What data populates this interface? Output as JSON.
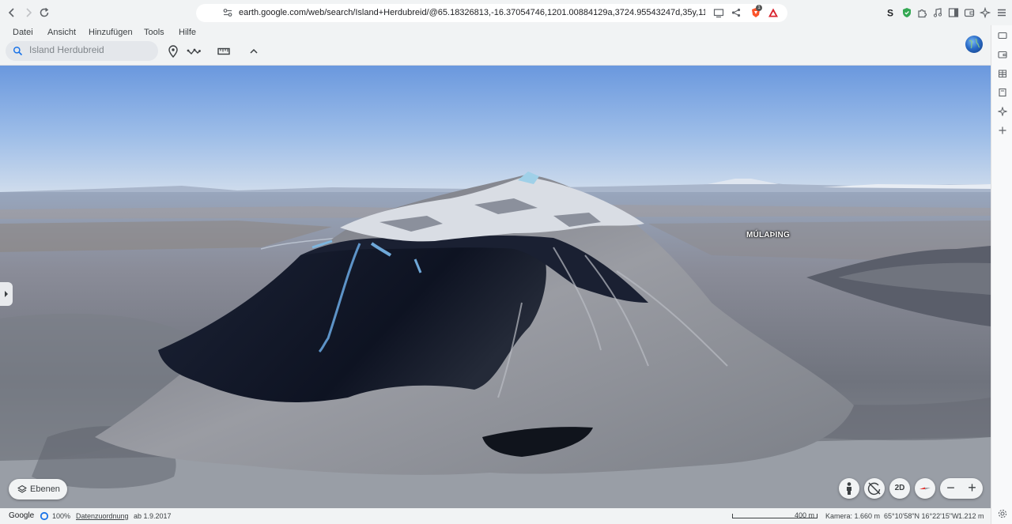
{
  "browser": {
    "url": "earth.google.com/web/search/Island+Herdubreid/@65.18326813,-16.37054746,1201.00884129a,3724.95543247d,35y,119.15478597h,82....",
    "brave_badge_count": "1"
  },
  "menu": {
    "items": [
      "Datei",
      "Ansicht",
      "Hinzufügen",
      "Tools",
      "Hilfe"
    ]
  },
  "search": {
    "placeholder": "Island Herdubreid"
  },
  "map": {
    "place_label": "MÚLAÞING"
  },
  "controls": {
    "layers_label": "Ebenen",
    "view_mode_label": "2D",
    "zoom_out": "−",
    "zoom_in": "+"
  },
  "status": {
    "google": "Google",
    "zoom_percent": "100%",
    "data_attribution": "Datenzuordnung",
    "imagery_date": "ab 1.9.2017",
    "scale": "400 m",
    "camera": "Kamera: 1.660 m",
    "coordinates": "65°10'58\"N 16°22'15\"W",
    "elevation": "1.212 m"
  },
  "colors": {
    "sky_top": "#6d9ae0",
    "sky_horizon": "#c7d6ec",
    "mountain_dark": "#12182b",
    "accent_blue": "#1a73e8",
    "compass_red": "#e53935"
  }
}
